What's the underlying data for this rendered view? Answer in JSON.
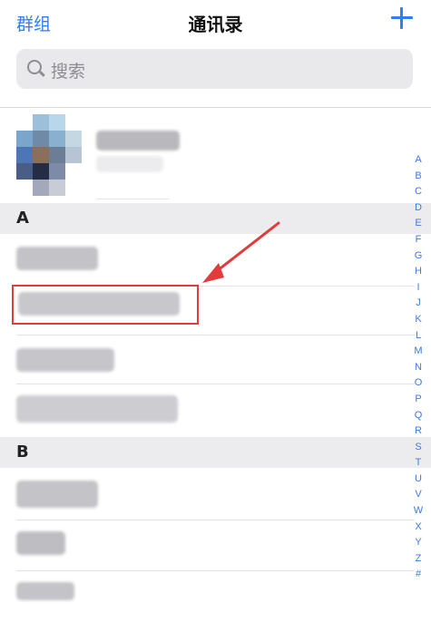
{
  "nav": {
    "left_label": "群组",
    "title": "通讯录",
    "add_icon": "plus-icon"
  },
  "search": {
    "placeholder": "搜索",
    "icon": "search-icon"
  },
  "sections": [
    {
      "letter": "A"
    },
    {
      "letter": "B"
    }
  ],
  "index_letters": [
    "A",
    "B",
    "C",
    "D",
    "E",
    "F",
    "G",
    "H",
    "I",
    "J",
    "K",
    "L",
    "M",
    "N",
    "O",
    "P",
    "Q",
    "R",
    "S",
    "T",
    "U",
    "V",
    "W",
    "X",
    "Y",
    "Z",
    "#"
  ],
  "colors": {
    "accent": "#2f7df6",
    "highlight_border": "#e23b3b",
    "section_bg": "#ececef"
  }
}
